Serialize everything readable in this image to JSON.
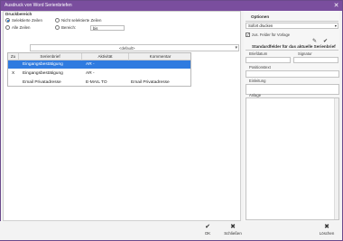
{
  "window": {
    "title": "Ausdruck von Word Serienbriefen",
    "close_glyph": "✕"
  },
  "druckbereich": {
    "title": "Druckbereich",
    "options": [
      {
        "label": "Selektierte Zeilen",
        "selected": true
      },
      {
        "label": "Nicht selektierte Zeilen",
        "selected": false
      },
      {
        "label": "Alle Zeilen",
        "selected": false
      },
      {
        "label": "Bereich:",
        "selected": false
      }
    ],
    "bis_label": "bis",
    "bis_value": ""
  },
  "template_combo": {
    "value": "<default>"
  },
  "grid": {
    "headers": [
      "Zu",
      "Serienbrief",
      "Aktivität",
      "Kommentar"
    ],
    "rows": [
      {
        "mark": "",
        "serienbrief": "Eingangsbestätigung",
        "aktivitaet": "AR -",
        "kommentar": "",
        "selected": true
      },
      {
        "mark": "X",
        "serienbrief": "Eingangsbestätigung",
        "aktivitaet": "AR -",
        "kommentar": "",
        "selected": false
      },
      {
        "mark": "",
        "serienbrief": "Email Privatadresse",
        "aktivitaet": "E-MAIL TO",
        "kommentar": "Email Privatadresse",
        "selected": false
      }
    ]
  },
  "optionen": {
    "title": "Optionen",
    "druck_mode": "Sofort drucken",
    "zus_felder_label": "zus. Felder für Vorlage",
    "zus_felder_checked": true
  },
  "standardfelder": {
    "title": "Standardfelder für das aktuelle Serienbrief",
    "briefdatum_label": "Briefdatum",
    "signatur_label": "Signatur",
    "positionstext_label": "Positionstext",
    "einleitung_label": "Einleitung",
    "anlage_label": "Anlage"
  },
  "buttons": {
    "ok_label": "OK",
    "schliessen_label": "Schließen",
    "loeschen_label": "Löschen"
  }
}
